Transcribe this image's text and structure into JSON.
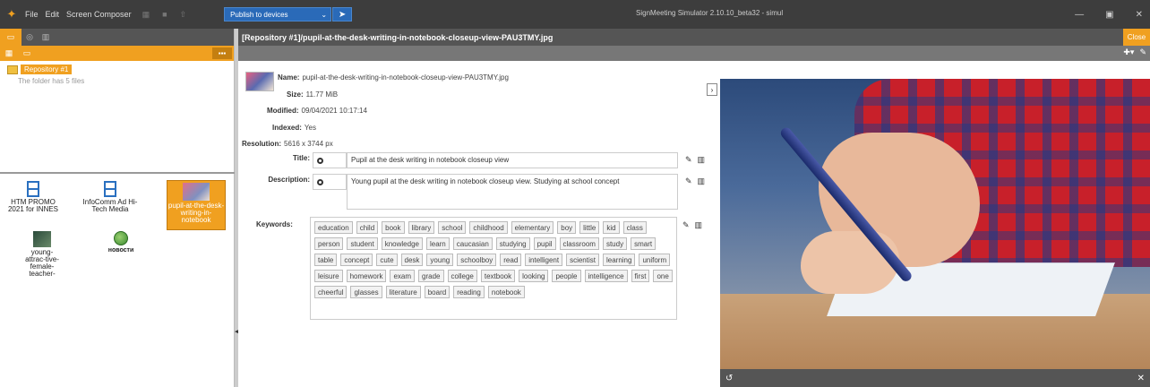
{
  "app": {
    "menu": [
      "File",
      "Edit",
      "Screen Composer"
    ],
    "publish_select": "Publish to devices",
    "window_title": "SignMeeting Simulator 2.10.10_beta32 - simul"
  },
  "left_panel": {
    "repo_label": "Repository #1",
    "folder_info": "The folder has 5 files",
    "files": [
      {
        "label": "HTM PROMO 2021 for INNES",
        "type": "video"
      },
      {
        "label": "InfoComm Ad Hi-Tech Media",
        "type": "video"
      },
      {
        "label": "pupil-at-the-desk-writing-in-notebook",
        "type": "image",
        "selected": true
      },
      {
        "label": "young-attrac-tive-female-teacher-",
        "type": "image"
      },
      {
        "label": "новости",
        "type": "web"
      }
    ]
  },
  "main": {
    "path": "[Repository #1]/pupil-at-the-desk-writing-in-notebook-closeup-view-PAU3TMY.jpg",
    "close_label": "Close",
    "props": {
      "name_label": "Name:",
      "name": "pupil-at-the-desk-writing-in-notebook-closeup-view-PAU3TMY.jpg",
      "size_label": "Size:",
      "size": "11.77 MiB",
      "modified_label": "Modified:",
      "modified": "09/04/2021 10:17:14",
      "indexed_label": "Indexed:",
      "indexed": "Yes",
      "resolution_label": "Resolution:",
      "resolution": "5616 x 3744 px"
    },
    "title_label": "Title:",
    "title_value": "Pupil at the desk writing in notebook closeup view",
    "description_label": "Description:",
    "description_value": "Young pupil at the desk writing in notebook closeup view. Studying at school concept",
    "keywords_label": "Keywords:",
    "keywords": [
      "education",
      "child",
      "book",
      "library",
      "school",
      "childhood",
      "elementary",
      "boy",
      "little",
      "kid",
      "class",
      "person",
      "student",
      "knowledge",
      "learn",
      "caucasian",
      "studying",
      "pupil",
      "classroom",
      "study",
      "smart",
      "table",
      "concept",
      "cute",
      "desk",
      "young",
      "schoolboy",
      "read",
      "intelligent",
      "scientist",
      "learning",
      "uniform",
      "leisure",
      "homework",
      "exam",
      "grade",
      "college",
      "textbook",
      "looking",
      "people",
      "intelligence",
      "first",
      "one",
      "cheerful",
      "glasses",
      "literature",
      "board",
      "reading",
      "notebook"
    ]
  }
}
